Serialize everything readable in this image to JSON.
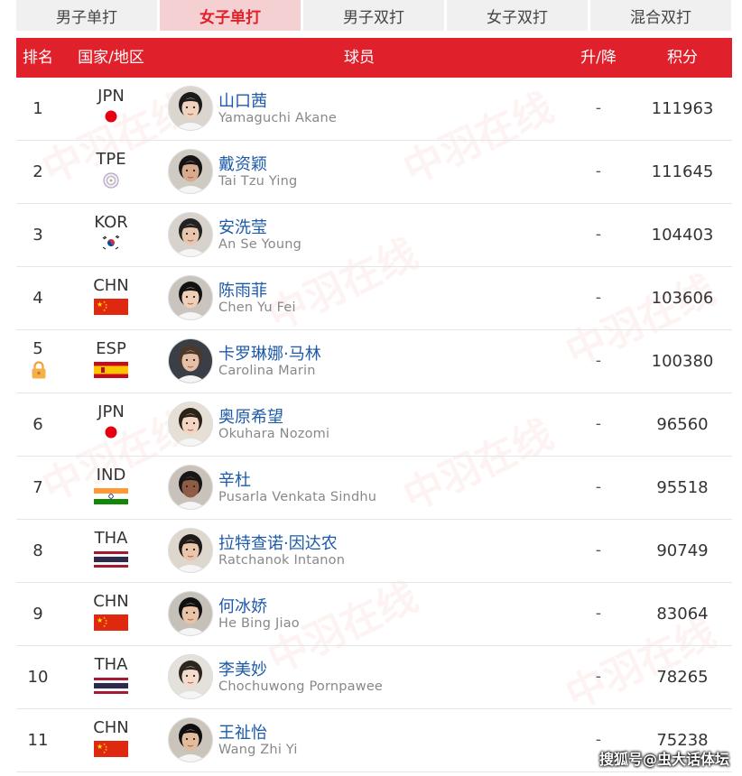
{
  "tabs": [
    {
      "label": "男子单打",
      "active": false
    },
    {
      "label": "女子单打",
      "active": true
    },
    {
      "label": "男子双打",
      "active": false
    },
    {
      "label": "女子双打",
      "active": false
    },
    {
      "label": "混合双打",
      "active": false
    }
  ],
  "header": {
    "rank": "排名",
    "country": "国家/地区",
    "player": "球员",
    "trend": "升/降",
    "points": "积分"
  },
  "rows": [
    {
      "rank": "1",
      "country": "JPN",
      "name_cn": "山口茜",
      "name_en": "Yamaguchi Akane",
      "trend": "-",
      "points": "111963",
      "flag": "jpn"
    },
    {
      "rank": "2",
      "country": "TPE",
      "name_cn": "戴资颖",
      "name_en": "Tai Tzu Ying",
      "trend": "-",
      "points": "111645",
      "flag": "tpe"
    },
    {
      "rank": "3",
      "country": "KOR",
      "name_cn": "安洗莹",
      "name_en": "An Se Young",
      "trend": "-",
      "points": "104403",
      "flag": "kor"
    },
    {
      "rank": "4",
      "country": "CHN",
      "name_cn": "陈雨菲",
      "name_en": "Chen Yu Fei",
      "trend": "-",
      "points": "103606",
      "flag": "chn"
    },
    {
      "rank": "5",
      "country": "ESP",
      "name_cn": "卡罗琳娜·马林",
      "name_en": "Carolina Marin",
      "trend": "-",
      "points": "100380",
      "flag": "esp",
      "locked": true
    },
    {
      "rank": "6",
      "country": "JPN",
      "name_cn": "奥原希望",
      "name_en": "Okuhara Nozomi",
      "trend": "-",
      "points": "96560",
      "flag": "jpn"
    },
    {
      "rank": "7",
      "country": "IND",
      "name_cn": "辛杜",
      "name_en": "Pusarla Venkata Sindhu",
      "trend": "-",
      "points": "95518",
      "flag": "ind"
    },
    {
      "rank": "8",
      "country": "THA",
      "name_cn": "拉特查诺·因达农",
      "name_en": "Ratchanok Intanon",
      "trend": "-",
      "points": "90749",
      "flag": "tha"
    },
    {
      "rank": "9",
      "country": "CHN",
      "name_cn": "何冰娇",
      "name_en": "He Bing Jiao",
      "trend": "-",
      "points": "83064",
      "flag": "chn"
    },
    {
      "rank": "10",
      "country": "THA",
      "name_cn": "李美妙",
      "name_en": "Chochuwong Pornpawee",
      "trend": "-",
      "points": "78265",
      "flag": "tha"
    },
    {
      "rank": "11",
      "country": "CHN",
      "name_cn": "王祉怡",
      "name_en": "Wang Zhi Yi",
      "trend": "-",
      "points": "75238",
      "flag": "chn"
    }
  ],
  "watermark": "中羽在线",
  "footer_mark": "搜狐号@虫大话体坛",
  "colors": {
    "header_bg": "#e0212b",
    "active_tab_bg": "#f5d0d3",
    "active_tab_text": "#e02129",
    "name_link": "#1d5aa8"
  }
}
